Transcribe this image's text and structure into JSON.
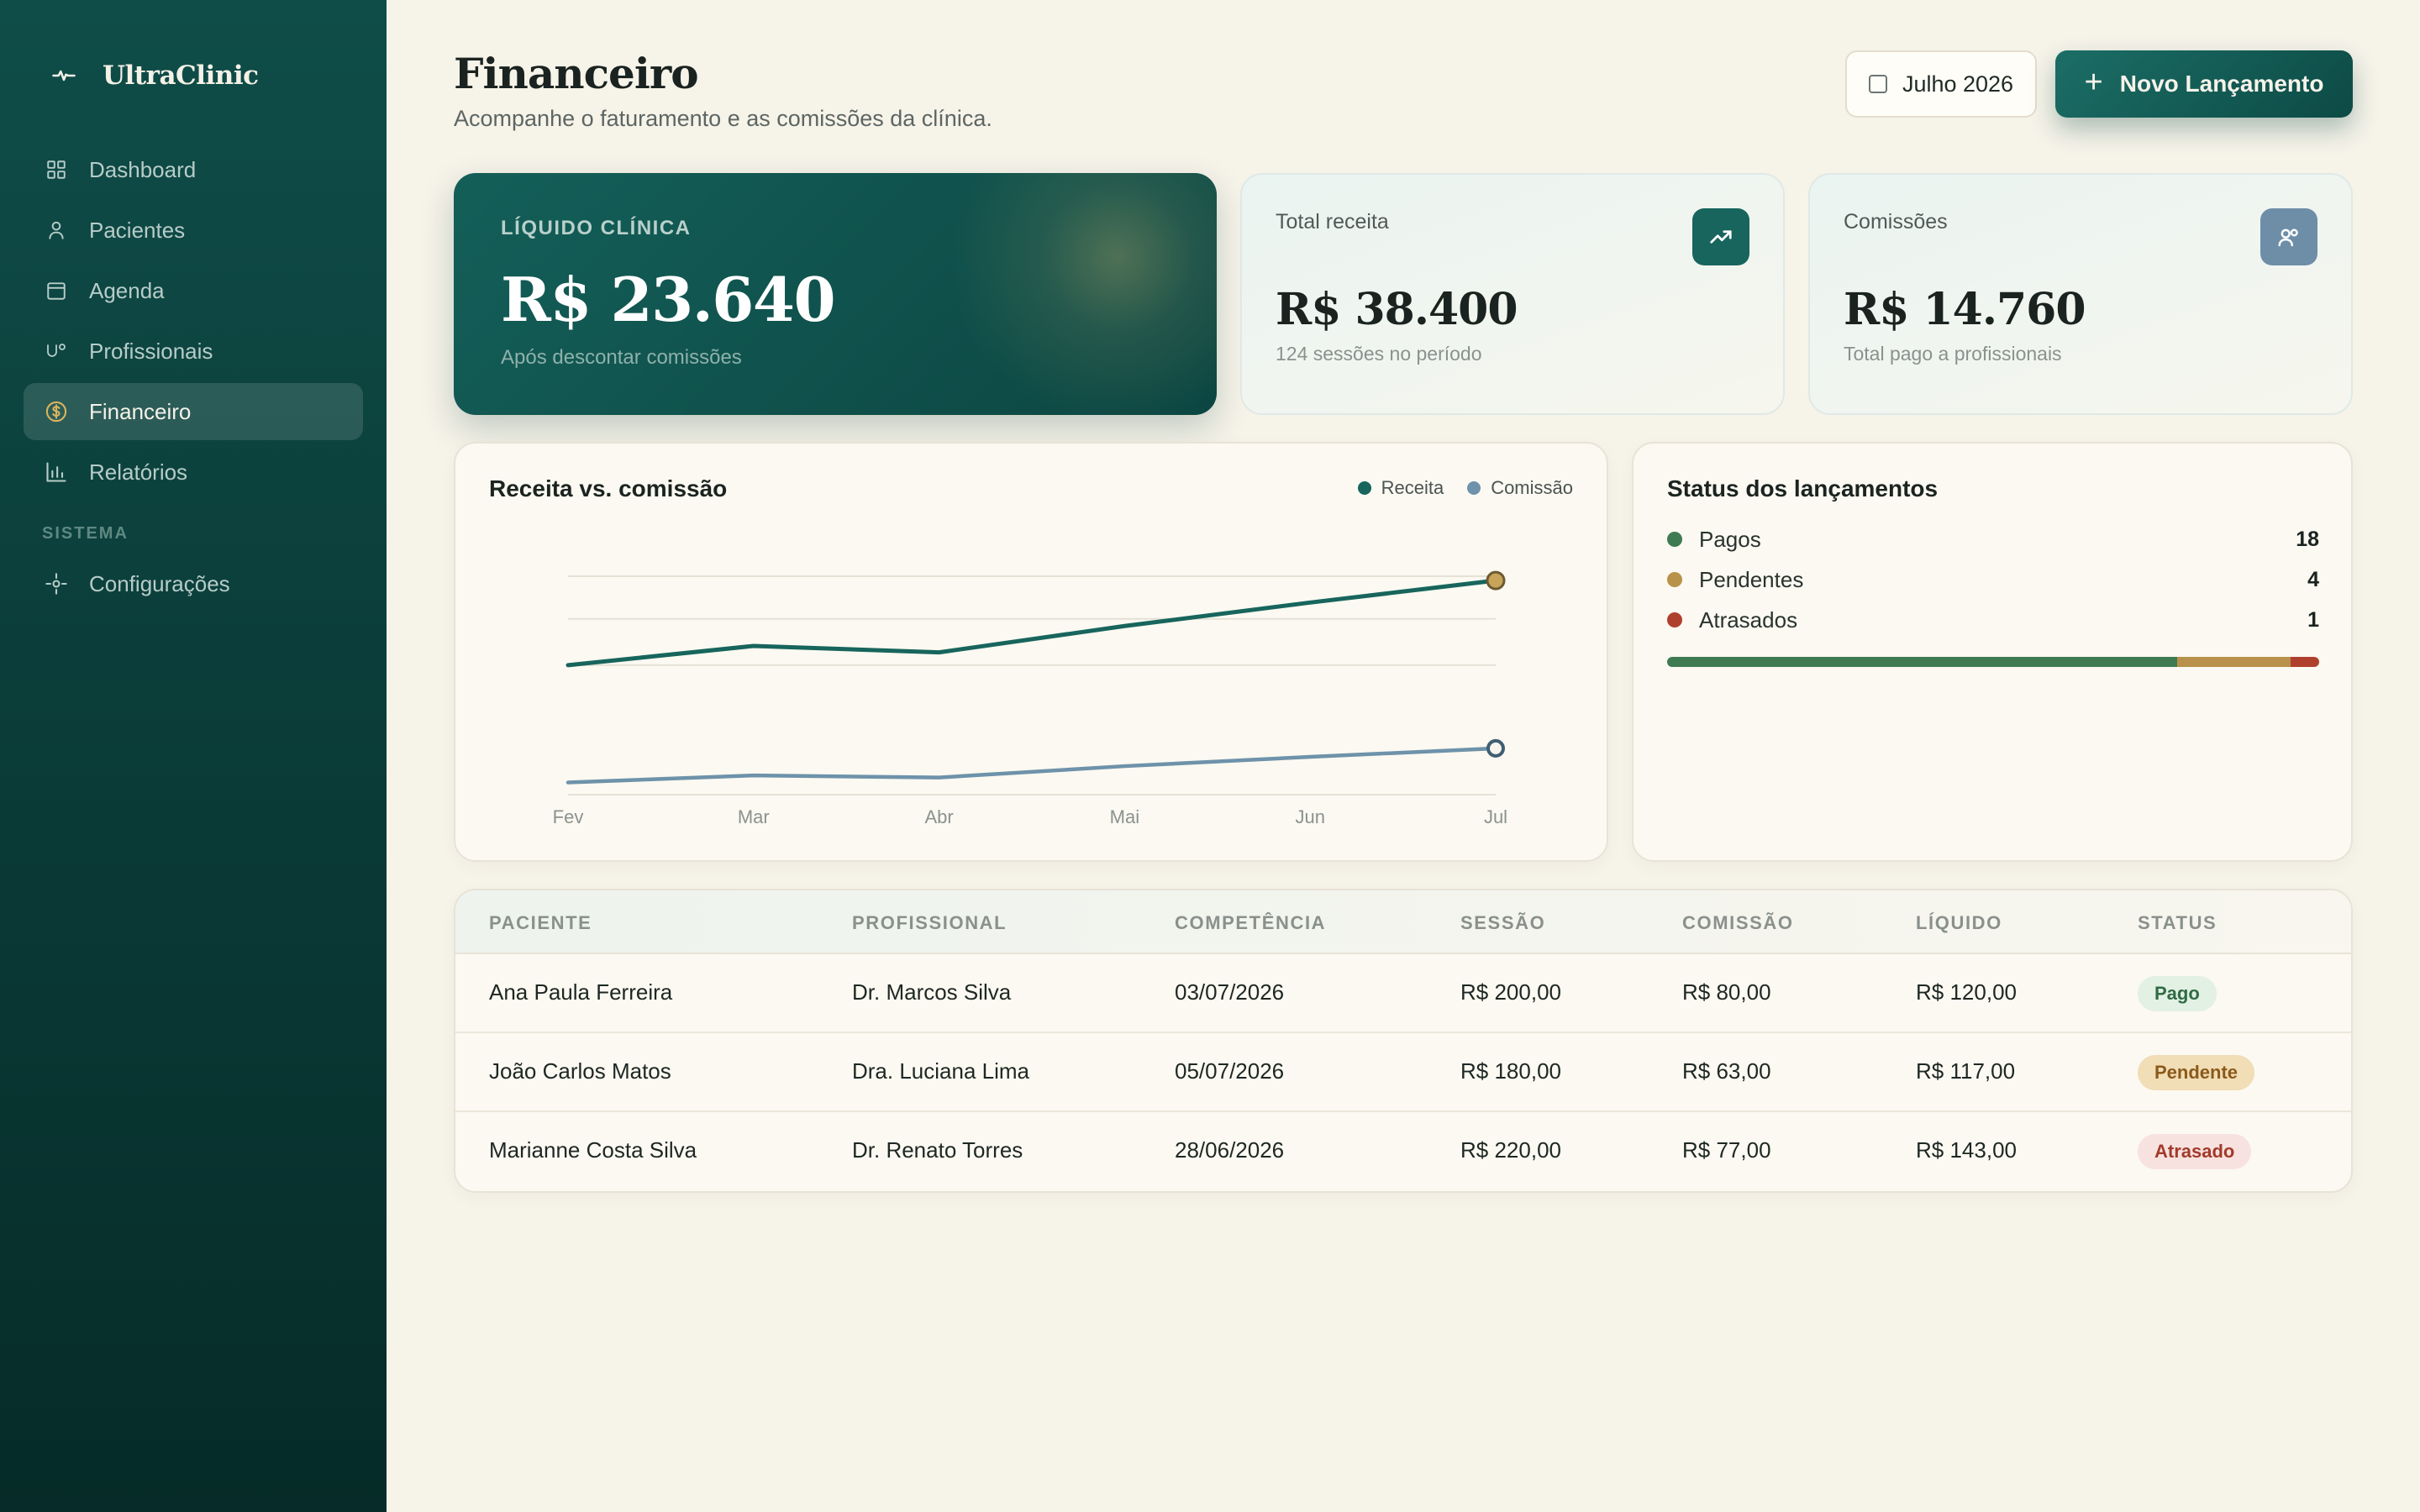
{
  "app": {
    "name": "UltraClinic"
  },
  "sidebar": {
    "items": [
      {
        "label": "Dashboard",
        "icon": "grid-icon",
        "active": false
      },
      {
        "label": "Pacientes",
        "icon": "user-icon",
        "active": false
      },
      {
        "label": "Agenda",
        "icon": "calendar-icon",
        "active": false
      },
      {
        "label": "Profissionais",
        "icon": "professionals-icon",
        "active": false
      },
      {
        "label": "Financeiro",
        "icon": "dollar-icon",
        "active": true
      },
      {
        "label": "Relatórios",
        "icon": "bar-chart-icon",
        "active": false
      }
    ],
    "section_label": "SISTEMA",
    "system_items": [
      {
        "label": "Configurações",
        "icon": "gear-icon"
      }
    ]
  },
  "header": {
    "title": "Financeiro",
    "subtitle": "Acompanhe o faturamento e as comissões da clínica.",
    "month_label": "Julho 2026",
    "new_button_label": "Novo Lançamento"
  },
  "kpis": {
    "hero": {
      "label": "LÍQUIDO CLÍNICA",
      "value": "R$ 23.640",
      "note": "Após descontar comissões"
    },
    "revenue": {
      "label": "Total receita",
      "value": "R$ 38.400",
      "note": "124 sessões no período",
      "icon": "trending-up-icon"
    },
    "commissions": {
      "label": "Comissões",
      "value": "R$ 14.760",
      "note": "Total pago a profissionais",
      "icon": "users-icon"
    }
  },
  "chart": {
    "title": "Receita vs. comissão",
    "legend": [
      "Receita",
      "Comissão"
    ]
  },
  "chart_data": {
    "type": "line",
    "x": [
      "Fev",
      "Mar",
      "Abr",
      "Mai",
      "Jun",
      "Jul"
    ],
    "series": [
      {
        "name": "Receita",
        "values": [
          26.5,
          29.2,
          28.3,
          32.0,
          35.3,
          38.4
        ],
        "color": "#17655d"
      },
      {
        "name": "Comissão",
        "values": [
          10.0,
          11.0,
          10.7,
          12.3,
          13.6,
          14.8
        ],
        "color": "#6e92aa"
      }
    ],
    "ylim": [
      9,
      39
    ],
    "gridlines": [
      39,
      33,
      26.5
    ],
    "grid": true,
    "legend_position": "top-right"
  },
  "status": {
    "title": "Status dos lançamentos",
    "items": [
      {
        "label": "Pagos",
        "count": "18",
        "value": 18,
        "color": "#3f7b52"
      },
      {
        "label": "Pendentes",
        "count": "4",
        "value": 4,
        "color": "#b8924a"
      },
      {
        "label": "Atrasados",
        "count": "1",
        "value": 1,
        "color": "#b0402e"
      }
    ]
  },
  "table": {
    "headers": [
      "PACIENTE",
      "PROFISSIONAL",
      "COMPETÊNCIA",
      "SESSÃO",
      "COMISSÃO",
      "LÍQUIDO",
      "STATUS"
    ],
    "rows": [
      {
        "patient": "Ana Paula Ferreira",
        "professional": "Dr. Marcos Silva",
        "date": "03/07/2026",
        "session": "R$ 200,00",
        "commission": "R$ 80,00",
        "net": "R$ 120,00",
        "status": "Pago"
      },
      {
        "patient": "João Carlos Matos",
        "professional": "Dra. Luciana Lima",
        "date": "05/07/2026",
        "session": "R$ 180,00",
        "commission": "R$ 63,00",
        "net": "R$ 117,00",
        "status": "Pendente"
      },
      {
        "patient": "Marianne Costa Silva",
        "professional": "Dr. Renato Torres",
        "date": "28/06/2026",
        "session": "R$ 220,00",
        "commission": "R$ 77,00",
        "net": "R$ 143,00",
        "status": "Atrasado"
      }
    ]
  },
  "colors": {
    "accent": "#0f4d49",
    "paid_bg": "#e3f0e4",
    "paid_fg": "#2f6b43",
    "pending_bg": "#f1ddb6",
    "pending_fg": "#8a5a1a",
    "late_bg": "#f7e2df",
    "late_fg": "#a33a2b"
  }
}
